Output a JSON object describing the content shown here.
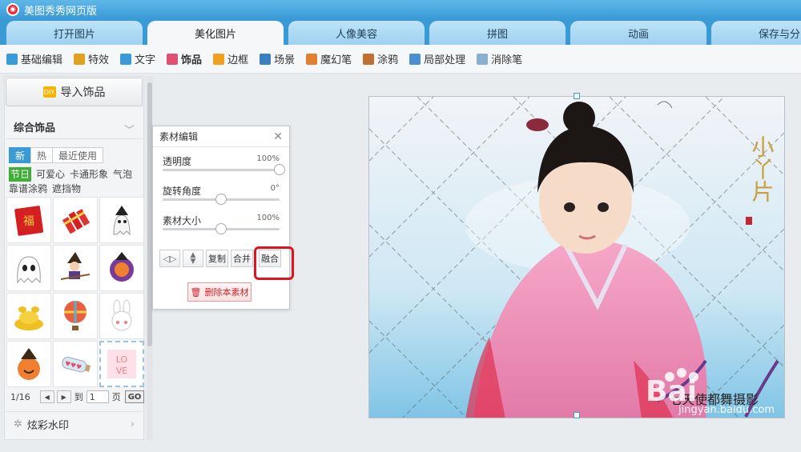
{
  "app": {
    "title": "美图秀秀网页版"
  },
  "tabs": [
    {
      "label": "打开图片",
      "active": false
    },
    {
      "label": "美化图片",
      "active": true
    },
    {
      "label": "人像美容",
      "active": false
    },
    {
      "label": "拼图",
      "active": false
    },
    {
      "label": "动画",
      "active": false
    },
    {
      "label": "保存与分",
      "active": false
    }
  ],
  "toolbar": [
    {
      "label": "基础编辑",
      "icon": "base-edit-icon",
      "color": "#3a9ad6"
    },
    {
      "label": "特效",
      "icon": "effects-brush-icon",
      "color": "#e0a020"
    },
    {
      "label": "文字",
      "icon": "text-t-icon",
      "color": "#3a9ad6"
    },
    {
      "label": "饰品",
      "icon": "bow-icon",
      "color": "#e05070"
    },
    {
      "label": "边框",
      "icon": "frame-icon",
      "color": "#f0a020"
    },
    {
      "label": "场景",
      "icon": "scene-icon",
      "color": "#3a80c0"
    },
    {
      "label": "魔幻笔",
      "icon": "magic-pen-icon",
      "color": "#e08030"
    },
    {
      "label": "涂鸦",
      "icon": "graffiti-icon",
      "color": "#c07030"
    },
    {
      "label": "局部处理",
      "icon": "local-process-icon",
      "color": "#4a90d0"
    },
    {
      "label": "消除笔",
      "icon": "eraser-pen-icon",
      "color": "#8ab0d0"
    }
  ],
  "leftpanel": {
    "import_label": "导入饰品",
    "section_title": "综合饰品",
    "subtabs": [
      "新",
      "热",
      "最近使用"
    ],
    "categories": [
      "节日",
      "可爱心",
      "卡通形象",
      "气泡",
      "靠谱涂鸦",
      "遮挡物"
    ],
    "stickers": [
      {
        "name": "fu-envelope-sticker",
        "color": "#d42020"
      },
      {
        "name": "firecracker-sticker",
        "color": "#e03030"
      },
      {
        "name": "ghost-hat-sticker",
        "color": "#f5f5f5"
      },
      {
        "name": "ghost-sticker",
        "color": "#ffffff"
      },
      {
        "name": "witch-broom-sticker",
        "color": "#3a2a1a"
      },
      {
        "name": "pumpkin-witch-sticker",
        "color": "#7a3a9a"
      },
      {
        "name": "gold-ingot-sticker",
        "color": "#f0c020"
      },
      {
        "name": "hot-air-balloon-sticker",
        "color": "#e86040"
      },
      {
        "name": "bunny-sticker",
        "color": "#ffffff"
      },
      {
        "name": "pumpkin-hat-sticker",
        "color": "#f08030"
      },
      {
        "name": "bottle-hearts-sticker",
        "color": "#d8e8f0"
      },
      {
        "name": "love-stamp-sticker",
        "color": "#f08080"
      }
    ],
    "pager": {
      "page_info": "1/16",
      "go_to": "到",
      "page_value": "1",
      "page_unit": "页",
      "go": "GO"
    },
    "watermark_section": "炫彩水印"
  },
  "dialog": {
    "title": "素材编辑",
    "opacity": {
      "label": "透明度",
      "value": "100%",
      "level": 1.0
    },
    "rotation": {
      "label": "旋转角度",
      "value": "0°",
      "level": 0.5
    },
    "size": {
      "label": "素材大小",
      "value": "100%",
      "level": 0.5
    },
    "buttons": {
      "copy": "复制",
      "merge": "合并",
      "fuse": "融合"
    },
    "delete_label": "删除本素材"
  },
  "canvas": {
    "title_text": "小丫片",
    "caption": "七天使都舞摄影",
    "watermark": "jingyan.baidu.com",
    "baidu_logo": "Bai"
  }
}
